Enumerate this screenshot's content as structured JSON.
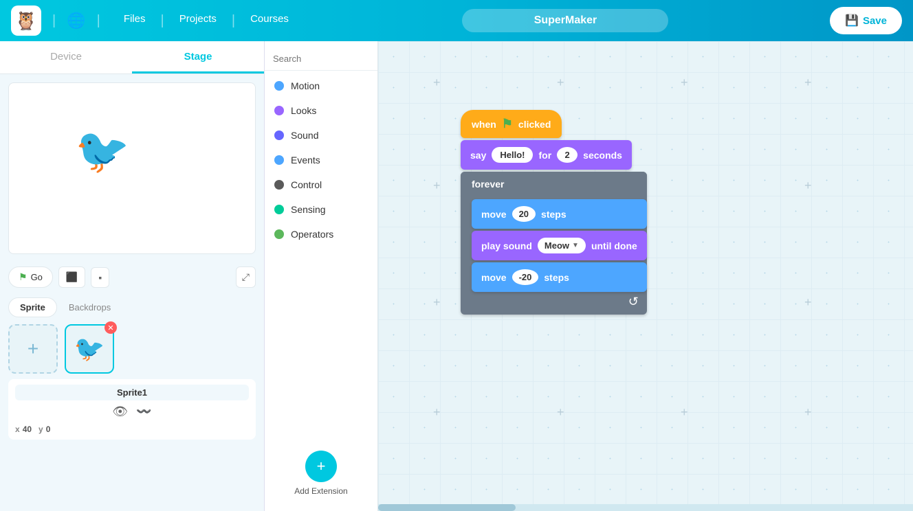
{
  "header": {
    "logo": "🦉",
    "globe_icon": "🌐",
    "nav_items": [
      "Files",
      "Projects",
      "Courses"
    ],
    "title": "SuperMaker",
    "save_label": "Save"
  },
  "tabs": {
    "device": "Device",
    "stage": "Stage",
    "active": "Stage"
  },
  "search": {
    "placeholder": "Search"
  },
  "categories": [
    {
      "name": "Motion",
      "color": "#4da6ff"
    },
    {
      "name": "Looks",
      "color": "#9966ff"
    },
    {
      "name": "Sound",
      "color": "#6666ff"
    },
    {
      "name": "Events",
      "color": "#4da6ff"
    },
    {
      "name": "Control",
      "color": "#5a5a5a"
    },
    {
      "name": "Sensing",
      "color": "#00cc99"
    },
    {
      "name": "Operators",
      "color": "#5cb85c"
    }
  ],
  "add_extension": "Add Extension",
  "stage_controls": {
    "go": "Go",
    "fullscreen": "⤢"
  },
  "sprite_area": {
    "sprite_tab": "Sprite",
    "backdrops_tab": "Backdrops",
    "sprite_name": "Sprite1",
    "x": "40",
    "y": "0"
  },
  "blocks": {
    "when_clicked": "when",
    "clicked": "clicked",
    "say": "say",
    "say_text": "Hello!",
    "for": "for",
    "seconds_num": "2",
    "seconds": "seconds",
    "forever": "forever",
    "move": "move",
    "move_steps": "20",
    "steps": "steps",
    "play_sound": "play sound",
    "meow": "Meow",
    "until_done": "until done",
    "move2": "move",
    "move2_steps": "-20",
    "steps2": "steps"
  }
}
